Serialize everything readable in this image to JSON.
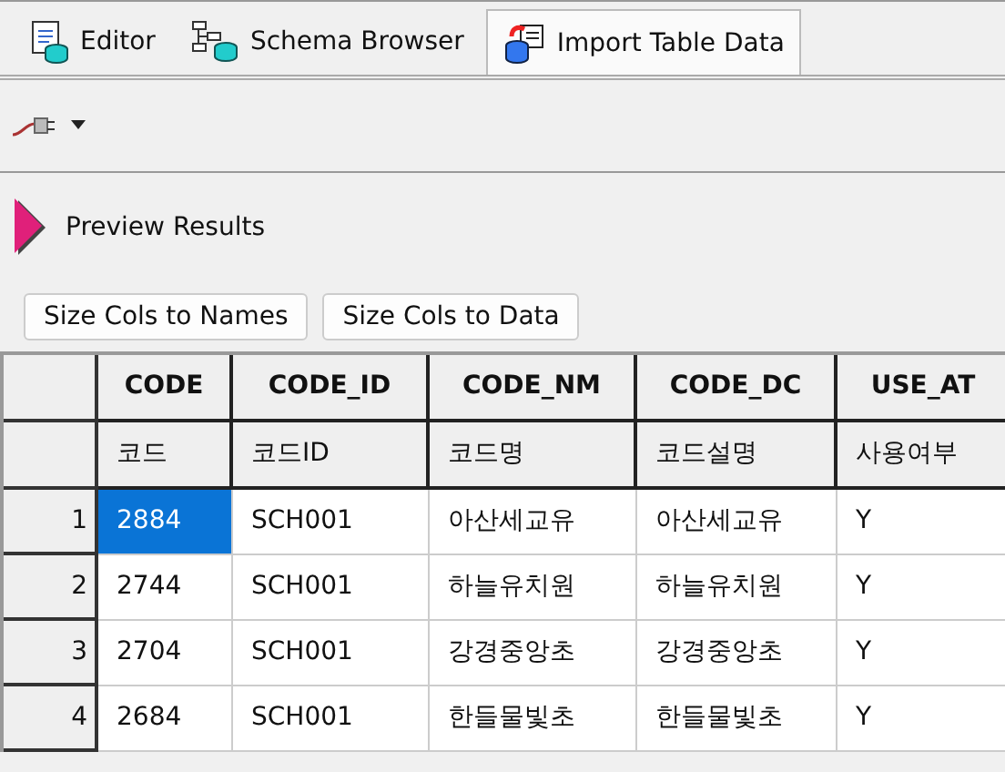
{
  "tabs": [
    {
      "label": "Editor",
      "kind": "editor",
      "selected": false
    },
    {
      "label": "Schema Browser",
      "kind": "schema",
      "selected": false
    },
    {
      "label": "Import Table Data",
      "kind": "import",
      "selected": true
    }
  ],
  "preview": {
    "label": "Preview Results"
  },
  "buttons": [
    "Size Cols to Names",
    "Size Cols to Data"
  ],
  "table": {
    "columns": [
      {
        "name": "CODE",
        "comment": "코드"
      },
      {
        "name": "CODE_ID",
        "comment": "코드ID"
      },
      {
        "name": "CODE_NM",
        "comment": "코드명"
      },
      {
        "name": "CODE_DC",
        "comment": "코드설명"
      },
      {
        "name": "USE_AT",
        "comment": "사용여부"
      }
    ],
    "rows": [
      {
        "number": "1",
        "cells": [
          {
            "text": "2884",
            "selected": true
          },
          {
            "text": "SCH001",
            "selected": false
          },
          {
            "text": "아산세교유",
            "selected": false
          },
          {
            "text": "아산세교유",
            "selected": false
          },
          {
            "text": "Y",
            "selected": false
          }
        ]
      },
      {
        "number": "2",
        "cells": [
          {
            "text": "2744",
            "selected": false
          },
          {
            "text": "SCH001",
            "selected": false
          },
          {
            "text": "하늘유치원",
            "selected": false
          },
          {
            "text": "하늘유치원",
            "selected": false
          },
          {
            "text": "Y",
            "selected": false
          }
        ]
      },
      {
        "number": "3",
        "cells": [
          {
            "text": "2704",
            "selected": false
          },
          {
            "text": "SCH001",
            "selected": false
          },
          {
            "text": "강경중앙초",
            "selected": false
          },
          {
            "text": "강경중앙초",
            "selected": false
          },
          {
            "text": "Y",
            "selected": false
          }
        ]
      },
      {
        "number": "4",
        "cells": [
          {
            "text": "2684",
            "selected": false
          },
          {
            "text": "SCH001",
            "selected": false
          },
          {
            "text": "한들물빛초",
            "selected": false
          },
          {
            "text": "한들물빛초",
            "selected": false
          },
          {
            "text": "Y",
            "selected": false
          }
        ]
      }
    ]
  }
}
